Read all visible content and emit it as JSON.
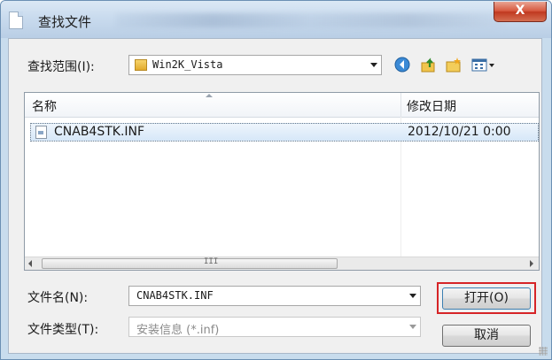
{
  "window": {
    "title": "查找文件",
    "close_label": "X"
  },
  "lookin": {
    "label": "查找范围(I):",
    "value": "Win2K_Vista"
  },
  "toolbar": {
    "back_icon": "back-arrow-icon",
    "up_icon": "up-folder-icon",
    "new_folder_icon": "new-folder-icon",
    "views_icon": "view-menu-icon"
  },
  "file_list": {
    "columns": [
      "名称",
      "修改日期"
    ],
    "rows": [
      {
        "name": "CNAB4STK.INF",
        "date": "2012/10/21 0:00"
      }
    ],
    "scroll_grip": "III"
  },
  "filename": {
    "label": "文件名(N):",
    "value": "CNAB4STK.INF"
  },
  "filetype": {
    "label": "文件类型(T):",
    "value": "安装信息 (*.inf)"
  },
  "buttons": {
    "open": "打开(O)",
    "cancel": "取消"
  },
  "colors": {
    "highlight_border": "#d62427",
    "close_button": "#c0381f",
    "title_bar": "#c9dbee"
  }
}
